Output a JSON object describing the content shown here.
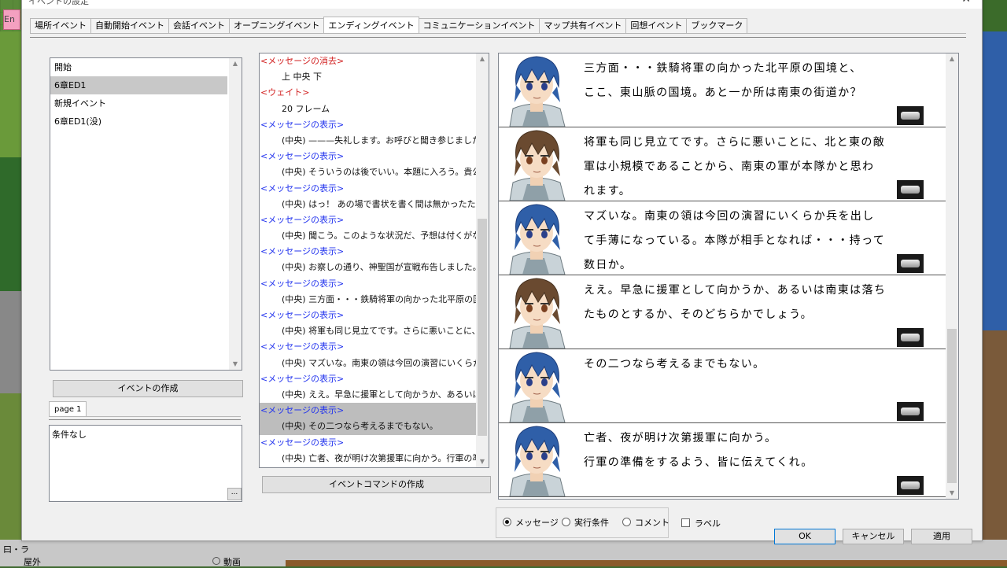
{
  "window": {
    "title": "イベントの設定",
    "min_glyph": "—",
    "close_glyph": "✕"
  },
  "tabs": [
    {
      "label": "場所イベント"
    },
    {
      "label": "自動開始イベント"
    },
    {
      "label": "会話イベント"
    },
    {
      "label": "オープニングイベント"
    },
    {
      "label": "エンディングイベント",
      "active": true
    },
    {
      "label": "コミュニケーションイベント"
    },
    {
      "label": "マップ共有イベント"
    },
    {
      "label": "回想イベント"
    },
    {
      "label": "ブックマーク"
    }
  ],
  "event_list": {
    "items": [
      "開始",
      "6章ED1",
      "新規イベント",
      "6章ED1(没)"
    ],
    "selected_index": 1,
    "create_button": "イベントの作成"
  },
  "page": {
    "tab_label": "page 1",
    "condition_text": "条件なし",
    "ellipsis_button": "..."
  },
  "command_list": {
    "lines": [
      {
        "text": "<メッセージの消去>",
        "kind": "r"
      },
      {
        "text": "上 中央 下",
        "kind": "b"
      },
      {
        "text": "<ウェイト>",
        "kind": "r"
      },
      {
        "text": "20 フレーム",
        "kind": "b"
      },
      {
        "text": "<メッセージの表示>",
        "kind": "h"
      },
      {
        "text": "(中央) ———失礼します。お呼びと聞き参じました。既",
        "kind": "b"
      },
      {
        "text": "<メッセージの表示>",
        "kind": "h"
      },
      {
        "text": "(中央) そういうのは後でいい。本題に入ろう。貴公は鉄",
        "kind": "b"
      },
      {
        "text": "<メッセージの表示>",
        "kind": "h"
      },
      {
        "text": "(中央) はっ！ あの場で書状を書く間は無かったため、",
        "kind": "b"
      },
      {
        "text": "<メッセージの表示>",
        "kind": "h"
      },
      {
        "text": "(中央) 聞こう。このような状況だ、予想は付くがな。",
        "kind": "b"
      },
      {
        "text": "<メッセージの表示>",
        "kind": "h"
      },
      {
        "text": "(中央) お察しの通り、神聖国が宣戦布告しました。正",
        "kind": "b"
      },
      {
        "text": "<メッセージの表示>",
        "kind": "h"
      },
      {
        "text": "(中央) 三方面・・・鉄騎将軍の向かった北平原の国境",
        "kind": "b"
      },
      {
        "text": "<メッセージの表示>",
        "kind": "h"
      },
      {
        "text": "(中央) 将軍も同じ見立てです。さらに悪いことに、北と",
        "kind": "b"
      },
      {
        "text": "<メッセージの表示>",
        "kind": "h"
      },
      {
        "text": "(中央) マズいな。南東の領は今回の演習にいくらか兵",
        "kind": "b"
      },
      {
        "text": "<メッセージの表示>",
        "kind": "h"
      },
      {
        "text": "(中央) ええ。早急に援軍として向かうか、あるいは南東",
        "kind": "b"
      },
      {
        "text": "<メッセージの表示>",
        "kind": "h",
        "selected": true
      },
      {
        "text": "(中央) その二つなら考えるまでもない。",
        "kind": "b",
        "selected": true
      },
      {
        "text": "<メッセージの表示>",
        "kind": "h"
      },
      {
        "text": "(中央) 亡者、夜が明け次第援軍に向かう。行軍の準",
        "kind": "b"
      }
    ],
    "create_button": "イベントコマンドの作成"
  },
  "preview": {
    "messages": [
      {
        "face": "blue",
        "lines": [
          "三方面・・・鉄騎将軍の向かった北平原の国境と、",
          "ここ、東山脈の国境。あと一か所は南東の街道か？"
        ]
      },
      {
        "face": "brown",
        "lines": [
          "将軍も同じ見立てです。さらに悪いことに、北と東の敵",
          "軍は小規模であることから、南東の軍が本隊かと思わ",
          "れます。"
        ]
      },
      {
        "face": "blue",
        "lines": [
          "マズいな。南東の領は今回の演習にいくらか兵を出し",
          "て手薄になっている。本隊が相手となれば・・・持って",
          "数日か。"
        ]
      },
      {
        "face": "brown",
        "lines": [
          "ええ。早急に援軍として向かうか、あるいは南東は落ち",
          "たものとするか、そのどちらかでしょう。"
        ]
      },
      {
        "face": "blue",
        "lines": [
          "その二つなら考えるまでもない。"
        ]
      },
      {
        "face": "blue",
        "lines": [
          "亡者、夜が明け次第援軍に向かう。",
          "行軍の準備をするよう、皆に伝えてくれ。"
        ]
      }
    ]
  },
  "view_mode": {
    "options": [
      {
        "label": "メッセージ",
        "selected": true
      },
      {
        "label": "実行条件",
        "selected": false
      },
      {
        "label": "コメント",
        "selected": false
      }
    ],
    "label_checkbox": "ラベル"
  },
  "buttons": {
    "ok": "OK",
    "cancel": "キャンセル",
    "apply": "適用"
  },
  "background": {
    "top_left": "En",
    "bottom_left_1": "曰・ラ",
    "bottom_left_2": "屋外",
    "bottom_mid": "動画"
  },
  "colors": {
    "header_blue": "#2233ee",
    "header_red": "#d22222",
    "selection_gray": "#c8c8c8"
  }
}
